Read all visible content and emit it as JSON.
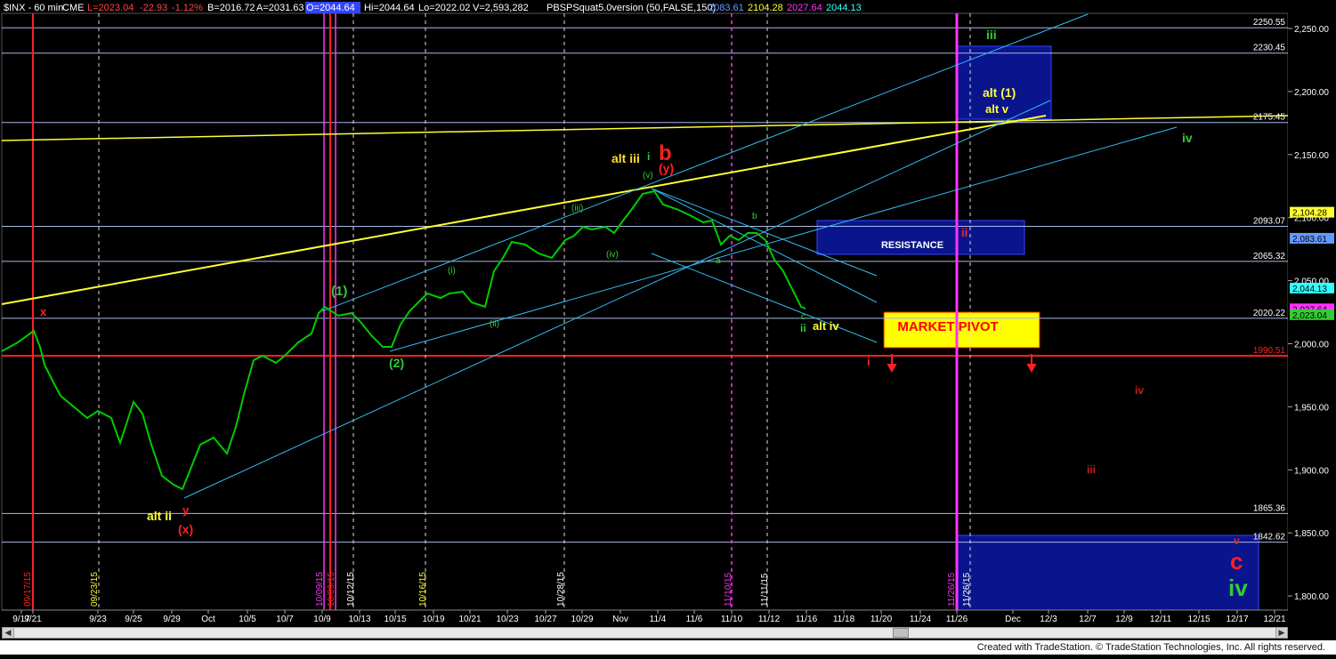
{
  "header": {
    "symbol": "$INX - 60 min",
    "exchange": "CME",
    "last": "L=2023.04",
    "change": "-22.93",
    "change_pct": "-1.12%",
    "bid": "B=2016.72",
    "ask": "A=2031.63",
    "open": "O=2044.64",
    "high": "Hi=2044.64",
    "low": "Lo=2022.02",
    "volume": "V=2,593,282",
    "indicator": "PBSPSquat5.0version (50,FALSE,150)",
    "ind_values": [
      "2083.61",
      "2104.28",
      "2027.64",
      "2044.13"
    ]
  },
  "colors": {
    "background": "#000000",
    "price_bars": "#00cc00",
    "yellow_line": "#ffff33",
    "cyan_channel": "#33bbee",
    "red_line": "#ff2020",
    "magenta_line": "#ff33ff",
    "blue_box": "#0a148c",
    "market_pivot_box": "#ffff00"
  },
  "footer": {
    "credit": "Created with TradeStation. © TradeStation Technologies, Inc. All rights reserved."
  },
  "chart_data": {
    "type": "line",
    "title": "$INX - 60 min",
    "ylim": [
      1775,
      2265
    ],
    "y_ticks": [
      1800,
      1850,
      1900,
      1950,
      2000,
      2050,
      2100,
      2150,
      2200,
      2250
    ],
    "y_tick_labels": [
      "1,800.00",
      "1,850.00",
      "1,900.00",
      "1,950.00",
      "2,000.00",
      "2,050.00",
      "2,100.00",
      "2,150.00",
      "2,200.00",
      "2,250.00"
    ],
    "x_tick_labels": [
      "9/17",
      "9/21",
      "9/23",
      "9/25",
      "9/29",
      "Oct",
      "10/5",
      "10/7",
      "10/9",
      "10/13",
      "10/15",
      "10/19",
      "10/21",
      "10/23",
      "10/27",
      "10/29",
      "Nov",
      "11/4",
      "11/6",
      "11/10",
      "11/12",
      "11/16",
      "11/18",
      "11/20",
      "11/24",
      "11/26",
      "Dec",
      "12/3",
      "12/7",
      "12/9",
      "12/11",
      "12/15",
      "12/17",
      "12/21"
    ],
    "price_path": [
      [
        "9/17",
        2000
      ],
      [
        "9/17",
        2020
      ],
      [
        "9/18",
        1995
      ],
      [
        "9/21",
        1965
      ],
      [
        "9/22",
        1958
      ],
      [
        "9/23",
        1945
      ],
      [
        "9/24",
        1938
      ],
      [
        "9/25",
        1952
      ],
      [
        "9/28",
        1930
      ],
      [
        "9/29",
        1878
      ],
      [
        "9/29",
        1872
      ],
      [
        "9/30",
        1910
      ],
      [
        "Oct",
        1925
      ],
      [
        "10/2",
        1915
      ],
      [
        "10/5",
        1985
      ],
      [
        "10/6",
        1988
      ],
      [
        "10/7",
        1995
      ],
      [
        "10/8",
        2012
      ],
      [
        "10/9",
        2017
      ],
      [
        "10/12",
        2015
      ],
      [
        "10/13",
        2000
      ],
      [
        "10/14",
        1993
      ],
      [
        "10/15",
        2012
      ],
      [
        "10/16",
        2025
      ],
      [
        "10/19",
        2030
      ],
      [
        "10/20",
        2028
      ],
      [
        "10/21",
        2030
      ],
      [
        "10/22",
        2050
      ],
      [
        "10/23",
        2075
      ],
      [
        "10/26",
        2068
      ],
      [
        "10/27",
        2060
      ],
      [
        "10/28",
        2075
      ],
      [
        "10/29",
        2088
      ],
      [
        "10/30",
        2090
      ],
      [
        "Nov",
        2085
      ],
      [
        "11/3",
        2110
      ],
      [
        "11/4",
        2112
      ],
      [
        "11/5",
        2100
      ],
      [
        "11/6",
        2098
      ],
      [
        "11/9",
        2075
      ],
      [
        "11/10",
        2082
      ],
      [
        "11/11",
        2090
      ],
      [
        "11/12",
        2062
      ],
      [
        "11/13",
        2040
      ],
      [
        "11/13",
        2023
      ]
    ],
    "horizontal_levels": [
      {
        "value": 2250.55,
        "label": "2250.55"
      },
      {
        "value": 2230.45,
        "label": "2230.45"
      },
      {
        "value": 2175.45,
        "label": "2175.45"
      },
      {
        "value": 2093.07,
        "label": "2093.07"
      },
      {
        "value": 2065.32,
        "label": "2065.32"
      },
      {
        "value": 2020.22,
        "label": "2020.22"
      },
      {
        "value": 1990.51,
        "label": "1990.51"
      },
      {
        "value": 1865.36,
        "label": "1865.36"
      },
      {
        "value": 1842.62,
        "label": "1842.62"
      }
    ],
    "indicator_tags": [
      {
        "value": 2104.28,
        "label": "2,104.28"
      },
      {
        "value": 2083.61,
        "label": "2,083.61"
      },
      {
        "value": 2044.13,
        "label": "2,044.13"
      },
      {
        "value": 2027.64,
        "label": "2,027.64"
      },
      {
        "value": 2023.04,
        "label": "2,023.04"
      }
    ],
    "vertical_markers": [
      {
        "date": "09/17/15",
        "label": "09/17/15"
      },
      {
        "date": "09/23/15",
        "label": "09/23/15"
      },
      {
        "date": "10/09/15",
        "label": "10/09/15"
      },
      {
        "date": "10/09/15",
        "label": "10/09/15"
      },
      {
        "date": "10/12/15",
        "label": "10/12/15"
      },
      {
        "date": "10/16/15",
        "label": "10/16/15"
      },
      {
        "date": "10/28/15",
        "label": "10/28/15"
      },
      {
        "date": "11/10/15",
        "label": "11/10/15"
      },
      {
        "date": "11/11/15",
        "label": "11/11/15"
      },
      {
        "date": "11/26/15",
        "label": "11/26/15"
      },
      {
        "date": "11/26/15",
        "label": "11/26/15"
      }
    ],
    "boxes": [
      {
        "label": "RESISTANCE",
        "from": 2065.32,
        "to": 2093.07
      },
      {
        "label": "MARKET PIVOT",
        "from": 1990.51,
        "to": 2020.22
      },
      {
        "label": "",
        "from": 2175.45,
        "to": 2230.45
      },
      {
        "label": "",
        "from": 1775,
        "to": 1842.62
      }
    ],
    "wave_labels": [
      "x",
      "(1)",
      "(2)",
      "alt ii",
      "y",
      "(x)",
      "alt iii",
      "i",
      "(v)",
      "b",
      "(y)",
      "(iii)",
      "(iv)",
      "(i)",
      "(ii)",
      "a",
      "b",
      "c",
      "ii",
      "alt iv",
      "alt (1)",
      "alt v",
      "iii",
      "iv",
      "ii",
      "i",
      "iv",
      "iii",
      "v",
      "c",
      "iv"
    ]
  }
}
